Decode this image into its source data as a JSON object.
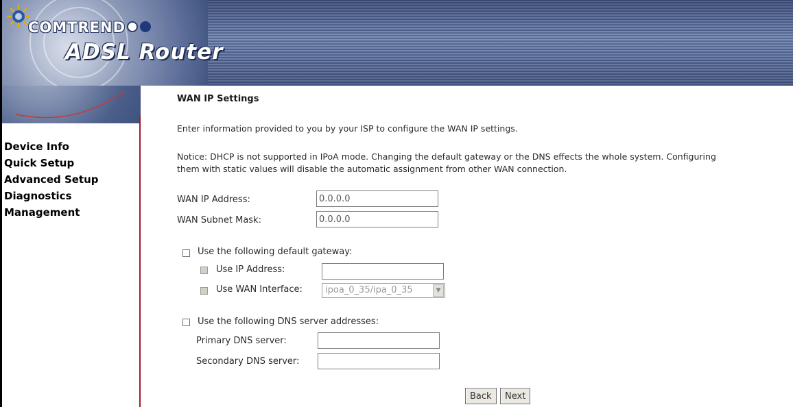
{
  "header": {
    "brand": "COMTREND",
    "product": "ADSL Router"
  },
  "nav": {
    "items": [
      {
        "label": "Device Info"
      },
      {
        "label": "Quick Setup"
      },
      {
        "label": "Advanced Setup"
      },
      {
        "label": "Diagnostics"
      },
      {
        "label": "Management"
      }
    ]
  },
  "page": {
    "title": "WAN IP Settings",
    "intro": "Enter information provided to you by your ISP to configure the WAN IP settings.",
    "notice_line1": "Notice: DHCP is not supported in IPoA mode. Changing the default gateway or the DNS effects the whole system. Configuring",
    "notice_line2": "them with static values will disable the automatic assignment from other WAN connection."
  },
  "wan": {
    "ip_label": "WAN IP Address:",
    "ip_value": "0.0.0.0",
    "mask_label": "WAN Subnet Mask:",
    "mask_value": "0.0.0.0"
  },
  "gateway": {
    "label": "Use the following default gateway:",
    "use_ip_label": "Use IP Address:",
    "use_ip_value": "",
    "use_wan_label": "Use WAN Interface:",
    "wan_interface_selected": "ipoa_0_35/ipa_0_35"
  },
  "dns": {
    "label": "Use the following DNS server addresses:",
    "primary_label": "Primary DNS server:",
    "primary_value": "",
    "secondary_label": "Secondary DNS server:",
    "secondary_value": ""
  },
  "buttons": {
    "back": "Back",
    "next": "Next"
  },
  "colors": {
    "sidebar_divider": "#a11a2c",
    "header_blue": "#4a5f8c"
  }
}
